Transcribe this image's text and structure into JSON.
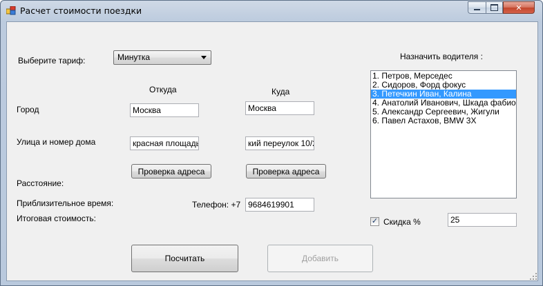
{
  "window": {
    "title": "Расчет стоимости поездки"
  },
  "tariff": {
    "label": "Выберите тариф:",
    "selected": "Минутка"
  },
  "columns": {
    "from": "Откуда",
    "to": "Куда"
  },
  "city": {
    "label": "Город",
    "from": "Москва",
    "to": "Москва"
  },
  "street": {
    "label": "Улица и номер дома",
    "from": "красная площадь",
    "to": "кий переулок 10/2"
  },
  "check_button": "Проверка адреса",
  "distance_label": "Расстояние:",
  "time_label": "Приблизительное время:",
  "total_label": "Итоговая стоимость:",
  "phone": {
    "label": "Телефон:  +7",
    "value": "9684619901"
  },
  "drivers": {
    "label": "Назначить водителя :",
    "items": [
      "1. Петров, Мерседес",
      "2. Сидоров, Форд фокус",
      "3. Петечкин Иван, Калина",
      "4. Анатолий Иванович, Шкада фабио",
      "5. Александр Сергеевич, Жигули",
      "6. Павел Астахов, BMW 3X"
    ],
    "selected_index": 2
  },
  "discount": {
    "label": "Скидка %",
    "checked": true,
    "value": "25"
  },
  "buttons": {
    "calculate": "Посчитать",
    "add": "Добавить"
  }
}
